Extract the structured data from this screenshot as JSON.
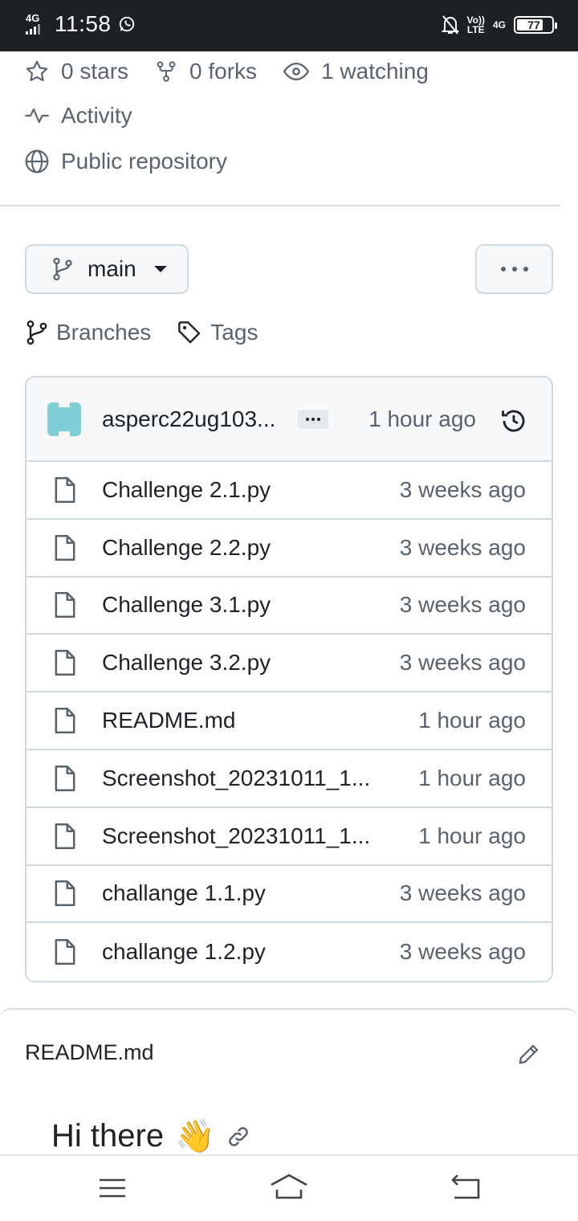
{
  "status_bar": {
    "network": "4G",
    "time": "11:58",
    "volte_top": "Vo))",
    "volte_bottom": "LTE",
    "network_right": "4G",
    "battery": "77"
  },
  "repo_meta": {
    "stars": "0 stars",
    "forks": "0 forks",
    "watching": "1 watching",
    "activity": "Activity",
    "visibility": "Public repository"
  },
  "branch": {
    "name": "main",
    "branches_label": "Branches",
    "tags_label": "Tags"
  },
  "latest_commit": {
    "author": "asperc22ug103...",
    "time": "1 hour ago"
  },
  "files": [
    {
      "name": "Challenge 2.1.py",
      "time": "3 weeks ago"
    },
    {
      "name": "Challenge 2.2.py",
      "time": "3 weeks ago"
    },
    {
      "name": "Challenge 3.1.py",
      "time": "3 weeks ago"
    },
    {
      "name": "Challenge 3.2.py",
      "time": "3 weeks ago"
    },
    {
      "name": "README.md",
      "time": "1 hour ago"
    },
    {
      "name": "Screenshot_20231011_1...",
      "time": "1 hour ago"
    },
    {
      "name": "Screenshot_20231011_1...",
      "time": "1 hour ago"
    },
    {
      "name": "challange 1.1.py",
      "time": "3 weeks ago"
    },
    {
      "name": "challange 1.2.py",
      "time": "3 weeks ago"
    }
  ],
  "readme": {
    "title": "README.md",
    "heading": "Hi there",
    "heading_emoji": "👋"
  },
  "icons": {
    "stars": "star-icon",
    "forks": "fork-icon",
    "watching": "eye-icon",
    "activity": "pulse-icon",
    "visibility": "globe-icon",
    "branch": "git-branch-icon",
    "tags": "tag-icon",
    "history": "history-icon",
    "file": "file-icon",
    "edit": "pencil-icon",
    "anchor": "link-icon"
  }
}
